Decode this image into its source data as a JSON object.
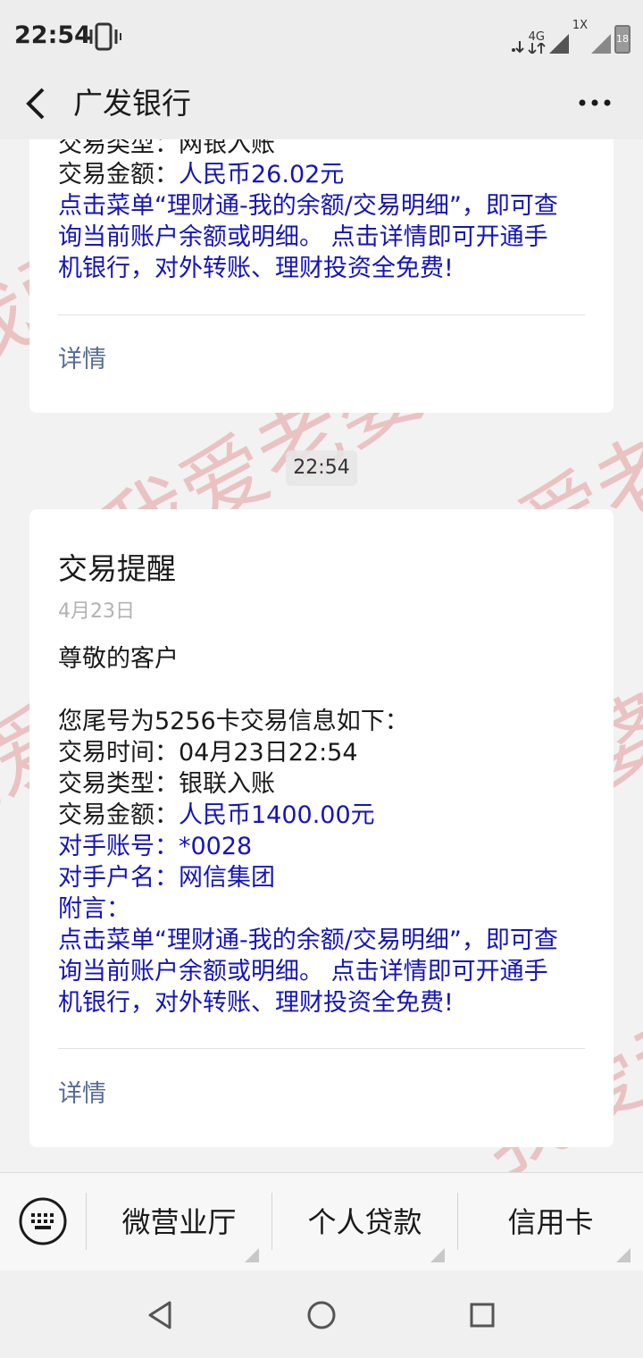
{
  "status": {
    "time": "22:54",
    "network": "4G",
    "sim": "1X",
    "battery": "18"
  },
  "header": {
    "title": "广发银行"
  },
  "card1": {
    "partial_line": "交易类型：网银入账",
    "amount_label": "交易金额：",
    "amount_value": "人民币26.02元",
    "note_lines": [
      "点击菜单“理财通-我的余额/交易明细”，即可查",
      "询当前账户余额或明细。 点击详情即可开通手",
      "机银行，对外转账、理财投资全免费!"
    ],
    "detail": "详情"
  },
  "timestamp": "22:54",
  "card2": {
    "title": "交易提醒",
    "date": "4月23日",
    "greeting": "尊敬的客户",
    "intro": "您尾号为5256卡交易信息如下：",
    "time_label": "交易时间：",
    "time_value": "04月23日22:54",
    "type_label": "交易类型：",
    "type_value": "银联入账",
    "amount_label": "交易金额：",
    "amount_value": "人民币1400.00元",
    "account_label": "对手账号：",
    "account_value": "*0028",
    "name_label": "对手户名：",
    "name_value": "网信集团",
    "memo_label": "附言：",
    "note_lines": [
      "点击菜单“理财通-我的余额/交易明细”，即可查",
      "询当前账户余额或明细。 点击详情即可开通手",
      "机银行，对外转账、理财投资全免费!"
    ],
    "detail": "详情"
  },
  "menu": {
    "items": [
      "微营业厅",
      "个人贷款",
      "信用卡"
    ]
  },
  "watermark": {
    "text": "我爱老婆",
    "color": "#e57373"
  },
  "colors": {
    "link_blue": "#1515b8",
    "detail_link": "#576b95"
  }
}
